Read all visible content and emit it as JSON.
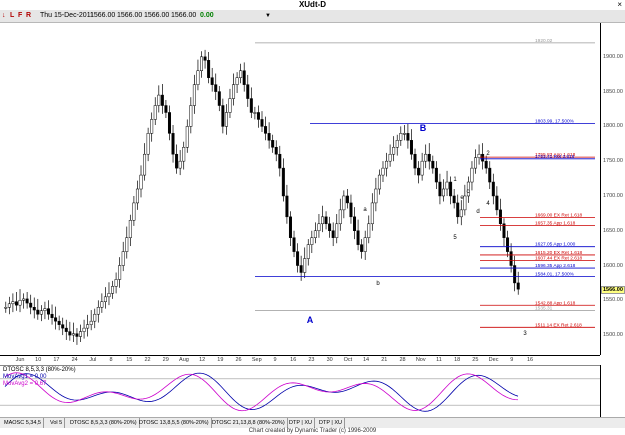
{
  "window": {
    "title": "XUdt-D",
    "close_glyph": "×"
  },
  "toolbar": {
    "icons": [
      "↓",
      "L",
      "F",
      "R"
    ],
    "date": "Thu 15-Dec-2011",
    "open": "1566.00",
    "high": "1566.00",
    "low": "1566.00",
    "close": "1566.00",
    "change": "0.00",
    "dropdown_arrow": "▼"
  },
  "price_axis": {
    "labels": [
      "1900.00",
      "1850.00",
      "1800.00",
      "1750.00",
      "1700.00",
      "1650.00",
      "1600.00",
      "1550.00",
      "1500.00"
    ],
    "current": "1566.00"
  },
  "date_axis": {
    "labels": [
      "Jun",
      "10",
      "17",
      "24",
      "Jul",
      "8",
      "15",
      "22",
      "29",
      "Aug",
      "12",
      "19",
      "26",
      "Sep",
      "9",
      "16",
      "23",
      "30",
      "Oct",
      "14",
      "21",
      "28",
      "Nov",
      "11",
      "18",
      "25",
      "Dec",
      "9",
      "16"
    ]
  },
  "chart_data": {
    "type": "candlestick",
    "ylim": [
      1480,
      1940
    ],
    "levels": [
      {
        "label": "1920.02",
        "value": 1920.02,
        "color": "#999999"
      },
      {
        "label": "1803.99, 17.500%",
        "value": 1803.99,
        "color": "#0000cc"
      },
      {
        "label": "1755.83 App 1.618",
        "value": 1755.83,
        "color": "#cc0000"
      },
      {
        "label": "1753.41 Ret 3.618",
        "value": 1753.41,
        "color": "#0000cc"
      },
      {
        "label": "1669.00 EX Ret 1.618",
        "value": 1669.0,
        "color": "#cc0000"
      },
      {
        "label": "1657.35 App 1.618",
        "value": 1657.35,
        "color": "#cc0000"
      },
      {
        "label": "1627.05 App 1.000",
        "value": 1627.05,
        "color": "#0000cc"
      },
      {
        "label": "1615.20 EX Ret 1.618",
        "value": 1615.2,
        "color": "#cc0000"
      },
      {
        "label": "1607.44 EX Ret 2.618",
        "value": 1607.44,
        "color": "#cc0000"
      },
      {
        "label": "1596.35 App 2.618",
        "value": 1596.35,
        "color": "#0000cc"
      },
      {
        "label": "1584.01, 17.500%",
        "value": 1584.01,
        "color": "#0000cc"
      },
      {
        "label": "1542.88 App 1.618",
        "value": 1542.88,
        "color": "#cc0000"
      },
      {
        "label": "1535.31",
        "value": 1535.31,
        "color": "#999999"
      },
      {
        "label": "1511.14 EX Ret 2.618",
        "value": 1511.14,
        "color": "#cc0000"
      }
    ],
    "wave_labels": [
      {
        "text": "A",
        "color": "#0000cc"
      },
      {
        "text": "B",
        "color": "#0000cc"
      },
      {
        "text": "a",
        "color": "#000000"
      },
      {
        "text": "b",
        "color": "#000000"
      },
      {
        "text": "1",
        "color": "#000000"
      },
      {
        "text": "2",
        "color": "#000000"
      },
      {
        "text": "3",
        "color": "#000000"
      },
      {
        "text": "4",
        "color": "#000000"
      },
      {
        "text": "5",
        "color": "#000000"
      },
      {
        "text": "c",
        "color": "#000000"
      },
      {
        "text": "d",
        "color": "#000000"
      },
      {
        "text": "e",
        "color": "#000000"
      }
    ],
    "candles_close": [
      1540,
      1545,
      1548,
      1543,
      1550,
      1552,
      1546,
      1540,
      1536,
      1530,
      1535,
      1538,
      1530,
      1525,
      1520,
      1515,
      1510,
      1505,
      1500,
      1502,
      1498,
      1505,
      1510,
      1515,
      1520,
      1530,
      1540,
      1548,
      1555,
      1560,
      1570,
      1580,
      1600,
      1620,
      1640,
      1665,
      1690,
      1710,
      1730,
      1760,
      1790,
      1810,
      1830,
      1845,
      1830,
      1820,
      1790,
      1760,
      1740,
      1750,
      1770,
      1800,
      1830,
      1860,
      1880,
      1900,
      1895,
      1870,
      1860,
      1850,
      1830,
      1800,
      1820,
      1840,
      1860,
      1870,
      1880,
      1860,
      1840,
      1820,
      1820,
      1810,
      1800,
      1790,
      1780,
      1770,
      1760,
      1740,
      1700,
      1670,
      1640,
      1620,
      1600,
      1590,
      1610,
      1630,
      1640,
      1650,
      1660,
      1670,
      1660,
      1650,
      1640,
      1660,
      1680,
      1700,
      1690,
      1670,
      1650,
      1630,
      1620,
      1640,
      1660,
      1690,
      1710,
      1730,
      1740,
      1750,
      1760,
      1770,
      1780,
      1790,
      1790,
      1780,
      1760,
      1740,
      1730,
      1750,
      1760,
      1750,
      1740,
      1720,
      1700,
      1710,
      1720,
      1700,
      1690,
      1670,
      1680,
      1700,
      1720,
      1740,
      1755,
      1760,
      1750,
      1740,
      1720,
      1700,
      1680,
      1660,
      1640,
      1620,
      1600,
      1575,
      1566
    ],
    "indicator": {
      "title": "DTOSC 8,5,3,3 (80%-20%)",
      "series": [
        {
          "name": "MovAvg1 = 0.00",
          "color": "#0000aa"
        },
        {
          "name": "MovAvg2 = 0.67",
          "color": "#cc00cc"
        }
      ],
      "levels": [
        80,
        20
      ]
    }
  },
  "tabs": [
    "MAOSC 5,34,5",
    "Vol 5",
    "DTOSC 8,5,3,3 (80%-20%)",
    "DTOSC 13,8,5,5 (80%-20%)",
    "DTOSC 21,13,8,8 (80%-20%)",
    "DTP | XU",
    "DTP | XU"
  ],
  "footer": "Chart created by Dynamic Trader  (c)  1996-2009"
}
